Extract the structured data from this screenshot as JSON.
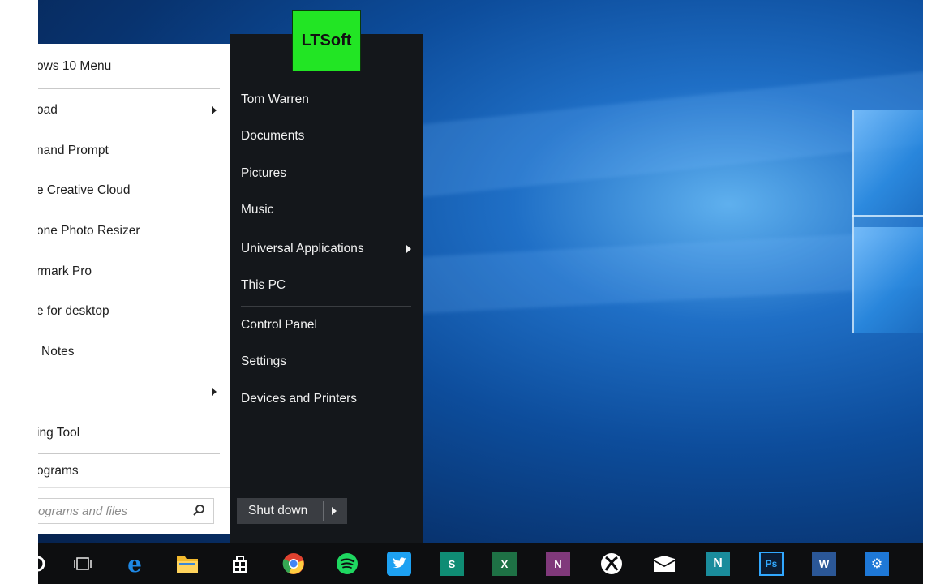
{
  "badge": {
    "text": "LTSoft"
  },
  "start_menu": {
    "left_items": [
      {
        "label": "ows 10 Menu",
        "arrow": false
      },
      {
        "label": "oad",
        "arrow": true
      },
      {
        "label": "nand Prompt",
        "arrow": false
      },
      {
        "label": "e Creative Cloud",
        "arrow": false
      },
      {
        "label": "one Photo Resizer",
        "arrow": false
      },
      {
        "label": "rmark Pro",
        "arrow": false
      },
      {
        "label": "e for desktop",
        "arrow": false
      },
      {
        "label": "Notes",
        "arrow": false
      },
      {
        "label": "",
        "arrow": true
      },
      {
        "label": "ing Tool",
        "arrow": false
      },
      {
        "label": "ograms",
        "arrow": false
      }
    ],
    "search_placeholder": "ograms and files",
    "right_items": [
      {
        "label": "Tom Warren",
        "arrow": false
      },
      {
        "label": "Documents",
        "arrow": false
      },
      {
        "label": "Pictures",
        "arrow": false
      },
      {
        "label": "Music",
        "arrow": false
      },
      {
        "label": "Universal Applications",
        "arrow": true
      },
      {
        "label": "This PC",
        "arrow": false
      },
      {
        "label": "Control Panel",
        "arrow": false
      },
      {
        "label": "Settings",
        "arrow": false
      },
      {
        "label": "Devices and Printers",
        "arrow": false
      }
    ],
    "shutdown_label": "Shut down"
  },
  "taskbar": {
    "icons": [
      {
        "name": "task-view-icon",
        "glyph": "",
        "color": "#0d0e10"
      },
      {
        "name": "edge-icon",
        "glyph": "e",
        "color": "#1e88e5"
      },
      {
        "name": "file-explorer-icon",
        "glyph": "",
        "color": "#f2b92e"
      },
      {
        "name": "store-icon",
        "glyph": "",
        "color": "#ffffff"
      },
      {
        "name": "chrome-icon",
        "glyph": "",
        "color": "#e0412f"
      },
      {
        "name": "spotify-icon",
        "glyph": "",
        "color": "#1ed760"
      },
      {
        "name": "twitter-icon",
        "glyph": "",
        "color": "#1da1f2"
      },
      {
        "name": "sway-icon",
        "glyph": "S",
        "color": "#0f8c74"
      },
      {
        "name": "excel-icon",
        "glyph": "X",
        "color": "#1e7145"
      },
      {
        "name": "onenote-icon",
        "glyph": "N",
        "color": "#80397b"
      },
      {
        "name": "xbox-icon",
        "glyph": "",
        "color": "#ffffff"
      },
      {
        "name": "mail-icon",
        "glyph": "",
        "color": "#ffffff"
      },
      {
        "name": "n-app-icon",
        "glyph": "N",
        "color": "#1a8c9c"
      },
      {
        "name": "photoshop-icon",
        "glyph": "Ps",
        "color": "#0b1c33"
      },
      {
        "name": "word-icon",
        "glyph": "W",
        "color": "#2b5797"
      },
      {
        "name": "settings-icon",
        "glyph": "⚙",
        "color": "#1e78d7"
      }
    ]
  }
}
